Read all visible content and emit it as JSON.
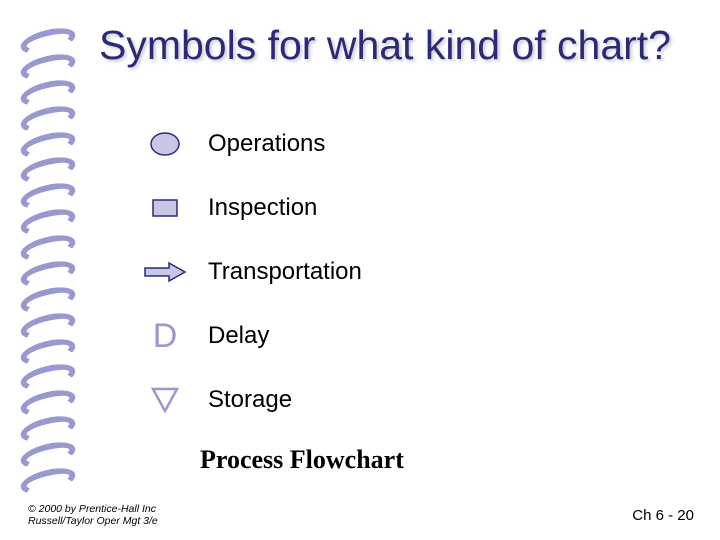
{
  "title": "Symbols for what kind of chart?",
  "items": [
    {
      "label": "Operations"
    },
    {
      "label": "Inspection"
    },
    {
      "label": "Transportation"
    },
    {
      "label": "Delay"
    },
    {
      "label": "Storage"
    }
  ],
  "delay_glyph": "D",
  "answer": "Process Flowchart",
  "copyright": {
    "line1": "© 2000 by Prentice-Hall Inc",
    "line2": "Russell/Taylor Oper Mgt 3/e"
  },
  "pagenum": "Ch 6 - 20",
  "colors": {
    "accent": "#9a99cf",
    "title": "#2a2a78",
    "fill": "#c7c6e4"
  }
}
